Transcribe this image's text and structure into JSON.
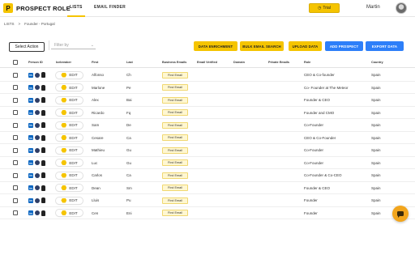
{
  "app": {
    "logo_letter": "P",
    "name": "PROSPECT ROLE"
  },
  "nav": {
    "lists": "LISTS",
    "email_finder": "EMAIL FINDER"
  },
  "trial": {
    "icon": "clock-icon",
    "label": "Trial"
  },
  "user": {
    "name": "Martin"
  },
  "breadcrumb": {
    "root": "LISTS",
    "separator": ">",
    "current": "Founder - Portugal"
  },
  "toolbar": {
    "select_action": "Select Action",
    "filter_placeholder": "Filter by",
    "data_enrichment": "DATA ENRICHMENT",
    "bulk_email_search": "BULK EMAIL SEARCH",
    "upload_data": "UPLOAD DATA",
    "add_prospect": "ADD PROSPECT",
    "export_data": "EXPORT DATA"
  },
  "colors": {
    "accent": "#f5c400",
    "blue": "#2d7ff9",
    "chat": "#f2a51c"
  },
  "table": {
    "headers": {
      "person_id": "Person ID",
      "icebreaker": "Icebreaker",
      "first": "First",
      "last": "Last",
      "business_emails": "Business Emails",
      "email_verified": "Email Verified",
      "domain": "Domain",
      "private_emails": "Private Emails",
      "role": "Role",
      "country": "Country"
    },
    "edit_label": "EDIT",
    "find_email_label": "Find Email",
    "rows": [
      {
        "first": "Alfonso",
        "last": "Ch",
        "role": "CEO & Co-founder",
        "country": "Spain"
      },
      {
        "first": "Marlone",
        "last": "Pe",
        "role": "Co- Founder at The Meteor",
        "country": "Spain"
      },
      {
        "first": "Alex",
        "last": "Bai",
        "role": "Founder & CEO",
        "country": "Spain"
      },
      {
        "first": "Ricardo",
        "last": "Fq",
        "role": "Founder and CMO",
        "country": "Spain"
      },
      {
        "first": "Sam",
        "last": "De",
        "role": "Co-Founder",
        "country": "Spain"
      },
      {
        "first": "Cesare",
        "last": "Ca",
        "role": "CEO & Co-Founder",
        "country": "Spain"
      },
      {
        "first": "Mathieu",
        "last": "Gu",
        "role": "Co-Founder",
        "country": "Spain"
      },
      {
        "first": "Luc",
        "last": "Gu",
        "role": "Co-Founder",
        "country": "Spain"
      },
      {
        "first": "Carlos",
        "last": "Ca",
        "role": "Co-Founder & Co-CEO",
        "country": "Spain"
      },
      {
        "first": "Dean",
        "last": "Sm",
        "role": "Founder & CEO",
        "country": "Spain"
      },
      {
        "first": "Lluis",
        "last": "Pu",
        "role": "Founder",
        "country": "Spain"
      },
      {
        "first": "Cen",
        "last": "Eni",
        "role": "Founder",
        "country": "Spain"
      }
    ]
  }
}
